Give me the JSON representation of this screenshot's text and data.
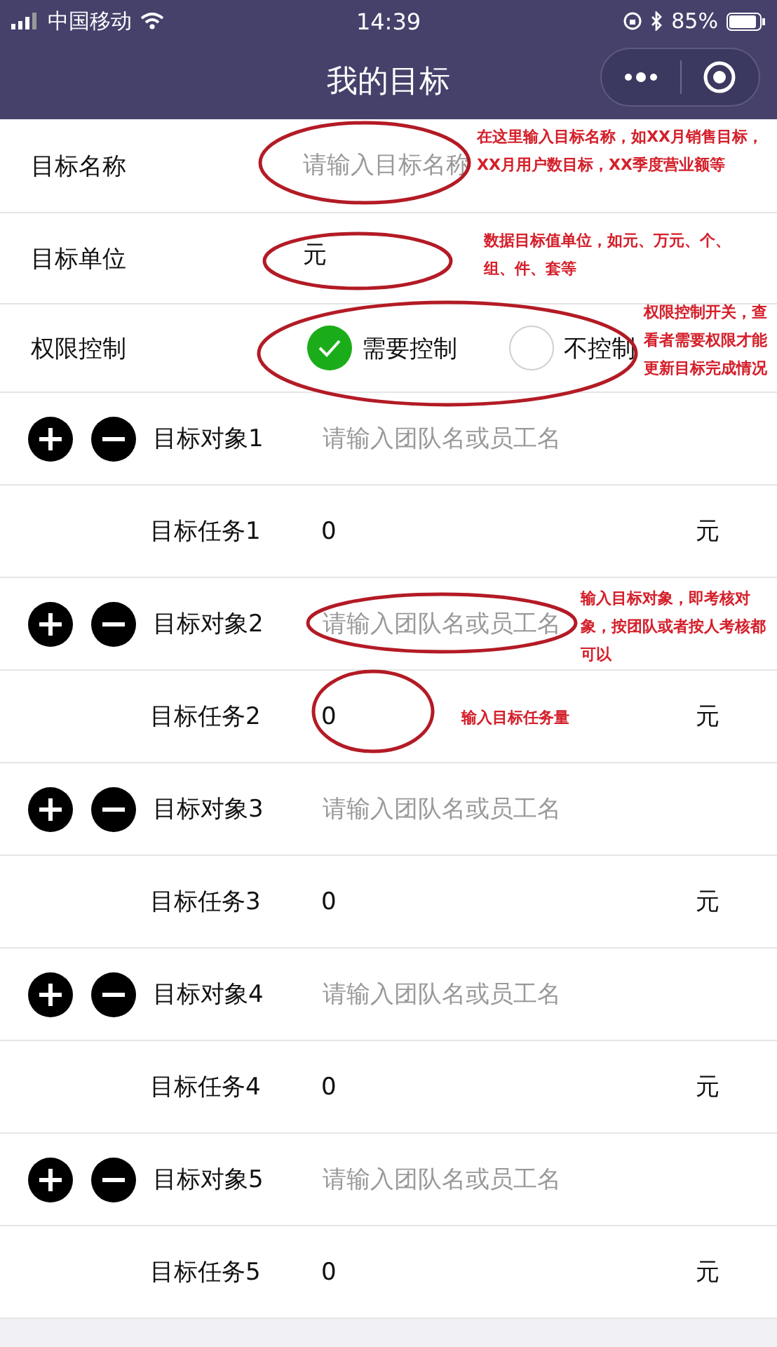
{
  "status_bar": {
    "carrier": "中国移动",
    "time": "14:39",
    "battery": "85%"
  },
  "nav": {
    "title": "我的目标"
  },
  "fields": [
    {
      "kind": "input",
      "label": "目标名称",
      "placeholder": "请输入目标名称"
    },
    {
      "kind": "input",
      "label": "目标单位",
      "value": "元"
    },
    {
      "kind": "radio",
      "label": "权限控制",
      "options": [
        {
          "label": "需要控制",
          "selected": true
        },
        {
          "label": "不控制",
          "selected": false
        }
      ]
    }
  ],
  "targets": [
    {
      "label": "目标对象1",
      "placeholder": "请输入团队名或员工名",
      "task_label": "目标任务1",
      "task_value": "0",
      "unit": "元"
    },
    {
      "label": "目标对象2",
      "placeholder": "请输入团队名或员工名",
      "task_label": "目标任务2",
      "task_value": "0",
      "unit": "元"
    },
    {
      "label": "目标对象3",
      "placeholder": "请输入团队名或员工名",
      "task_label": "目标任务3",
      "task_value": "0",
      "unit": "元"
    },
    {
      "label": "目标对象4",
      "placeholder": "请输入团队名或员工名",
      "task_label": "目标任务4",
      "task_value": "0",
      "unit": "元"
    },
    {
      "label": "目标对象5",
      "placeholder": "请输入团队名或员工名",
      "task_label": "目标任务5",
      "task_value": "0",
      "unit": "元"
    }
  ],
  "annotations": [
    "在这里输入目标名称，如XX月销售目标，XX月用户数目标，XX季度营业额等",
    "数据目标值单位，如元、万元、个、组、件、套等",
    "权限控制开关，查看者需要权限才能更新目标完成情况",
    "输入目标对象，即考核对象，按团队或者按人考核都可以",
    "输入目标任务量"
  ]
}
